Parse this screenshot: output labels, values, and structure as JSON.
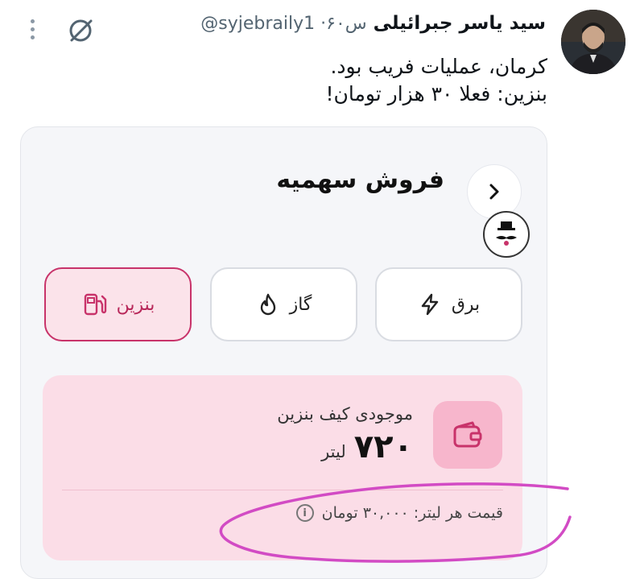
{
  "tweet": {
    "author_name": "سید یاسر جبرائیلی",
    "author_meta": "@syjebraily1 ·۶۰س",
    "text_lines": [
      "کرمان، عملیات فریب بود.",
      "بنزین: فعلا ۳۰ هزار تومان!"
    ]
  },
  "card": {
    "title": "فروش سهمیه",
    "tabs": [
      {
        "label": "برق",
        "icon": "lightning-icon",
        "active": false
      },
      {
        "label": "گاز",
        "icon": "flame-icon",
        "active": false
      },
      {
        "label": "بنزین",
        "icon": "fuel-pump-icon",
        "active": true
      }
    ],
    "balance": {
      "label": "موجودی کیف بنزین",
      "value": "۷۲۰",
      "unit": "لیتر"
    },
    "price_per_liter": "قیمت هر لیتر: ۳۰,۰۰۰ تومان"
  },
  "colors": {
    "accent": "#c8336a",
    "balance_bg": "#fbdde7",
    "scribble": "#d24bc4"
  }
}
